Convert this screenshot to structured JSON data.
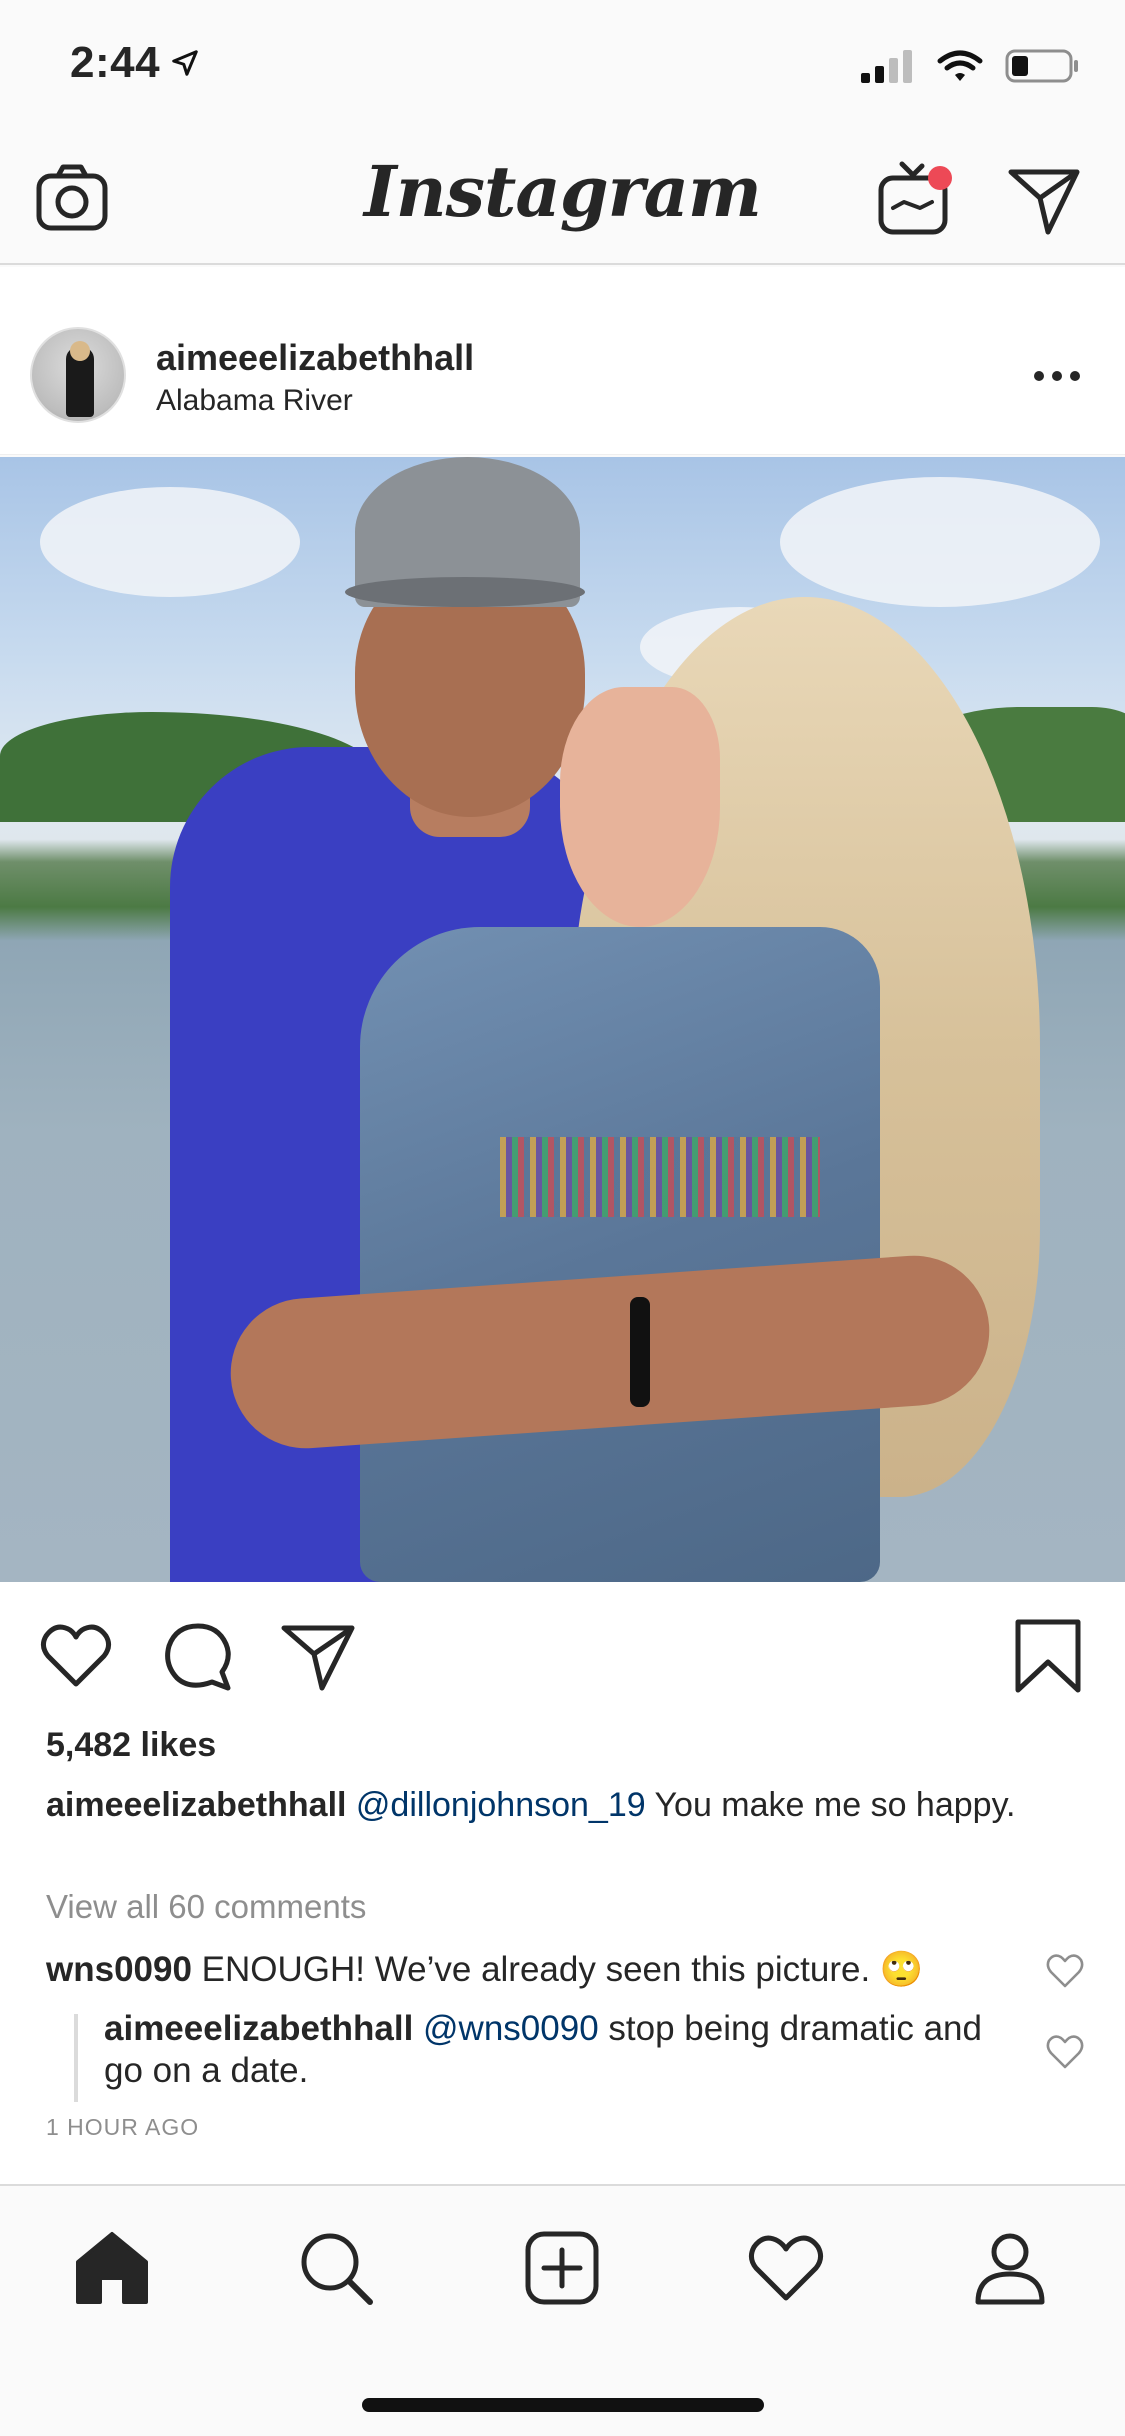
{
  "status_bar": {
    "time": "2:44"
  },
  "app": {
    "title": "Instagram"
  },
  "post": {
    "username": "aimeeelizabethhall",
    "location": "Alabama River",
    "likes": "5,482 likes",
    "caption": {
      "username": "aimeeelizabethhall",
      "mention": "@dillonjohnson_19",
      "text": " You make me so happy."
    },
    "view_all_comments": "View all 60 comments",
    "comments": [
      {
        "username": "wns0090",
        "text": " ENOUGH! We’ve already seen this picture. 🙄"
      },
      {
        "username": "aimeeelizabethhall",
        "mention": "@wns0090",
        "text": " stop being dramatic and go on a date."
      }
    ],
    "timestamp": "1 HOUR AGO"
  },
  "icons": {
    "top_nav": [
      "camera-icon",
      "igtv-icon",
      "direct-message-icon"
    ],
    "actions": [
      "heart-icon",
      "comment-icon",
      "share-icon",
      "bookmark-icon"
    ],
    "tab_bar": [
      "home-icon",
      "search-icon",
      "new-post-icon",
      "activity-icon",
      "profile-icon"
    ]
  },
  "colors": {
    "notification_dot": "#ed4956",
    "mention": "#003569",
    "muted_text": "#8e8e8e"
  }
}
